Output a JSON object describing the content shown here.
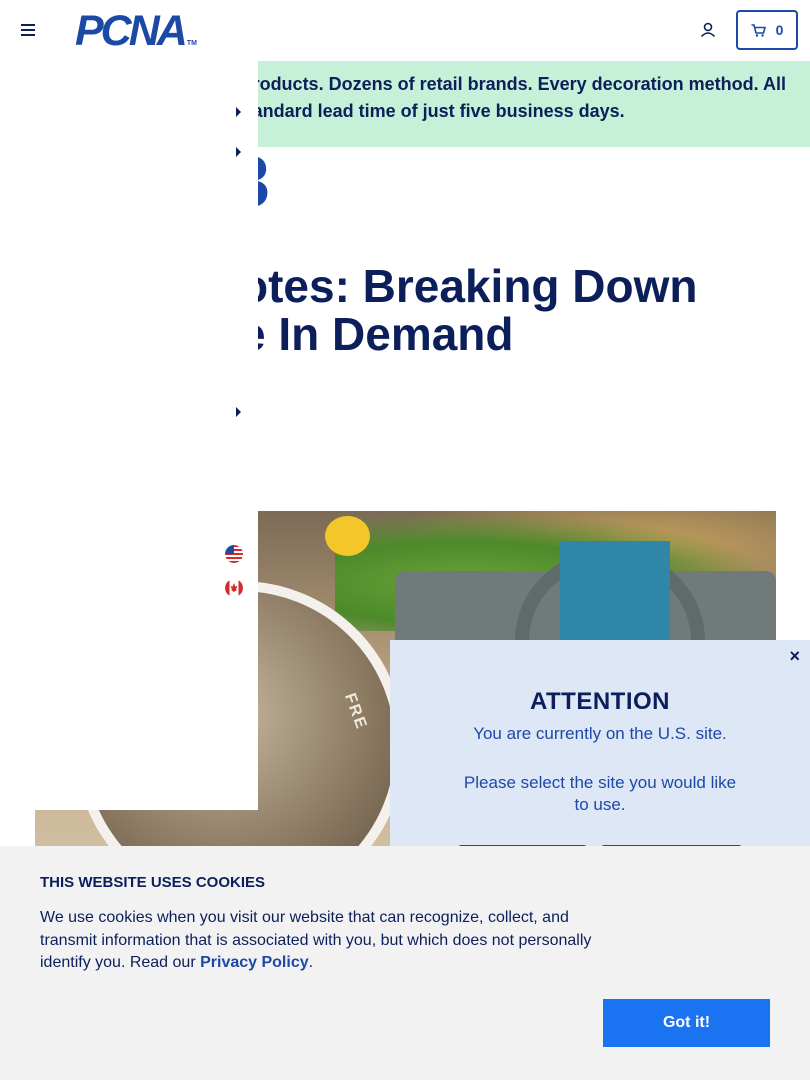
{
  "header": {
    "logo_text": "PCNA",
    "logo_tm": "TM",
    "cart_count": "0",
    "icons": {
      "menu": "hamburger-icon",
      "account": "user-icon",
      "cart": "cart-icon"
    }
  },
  "promo": {
    "line1": "roducts. Dozens of retail brands. Every decoration method. All",
    "line2": "andard lead time of just five business days."
  },
  "partial_glyph": "3",
  "headline": {
    "line1": "otes: Breaking Down",
    "line2": "e In Demand"
  },
  "hero": {
    "circle_text": "FRE"
  },
  "side_menu": {
    "flags": [
      "us-flag-icon",
      "canada-flag-icon"
    ]
  },
  "attention": {
    "title": "ATTENTION",
    "message": "You are currently on the U.S. site.",
    "prompt": "Please select the site you would like to use.",
    "close_label": "×"
  },
  "cookie_banner": {
    "title": "THIS WEBSITE USES COOKIES",
    "body": "We use cookies when you visit our website that can recognize, collect, and transmit information that is associated with you, but which does not personally identify you. Read our ",
    "link": "Privacy Policy",
    "suffix": ".",
    "button": "Got it!"
  },
  "colors": {
    "brand_blue": "#1d49a6",
    "navy": "#0c1f5b",
    "promo_bg": "#c6f0d8",
    "modal_bg": "#dde7f6",
    "cookie_bg": "#f2f2f2",
    "button_blue": "#1a73f0"
  }
}
